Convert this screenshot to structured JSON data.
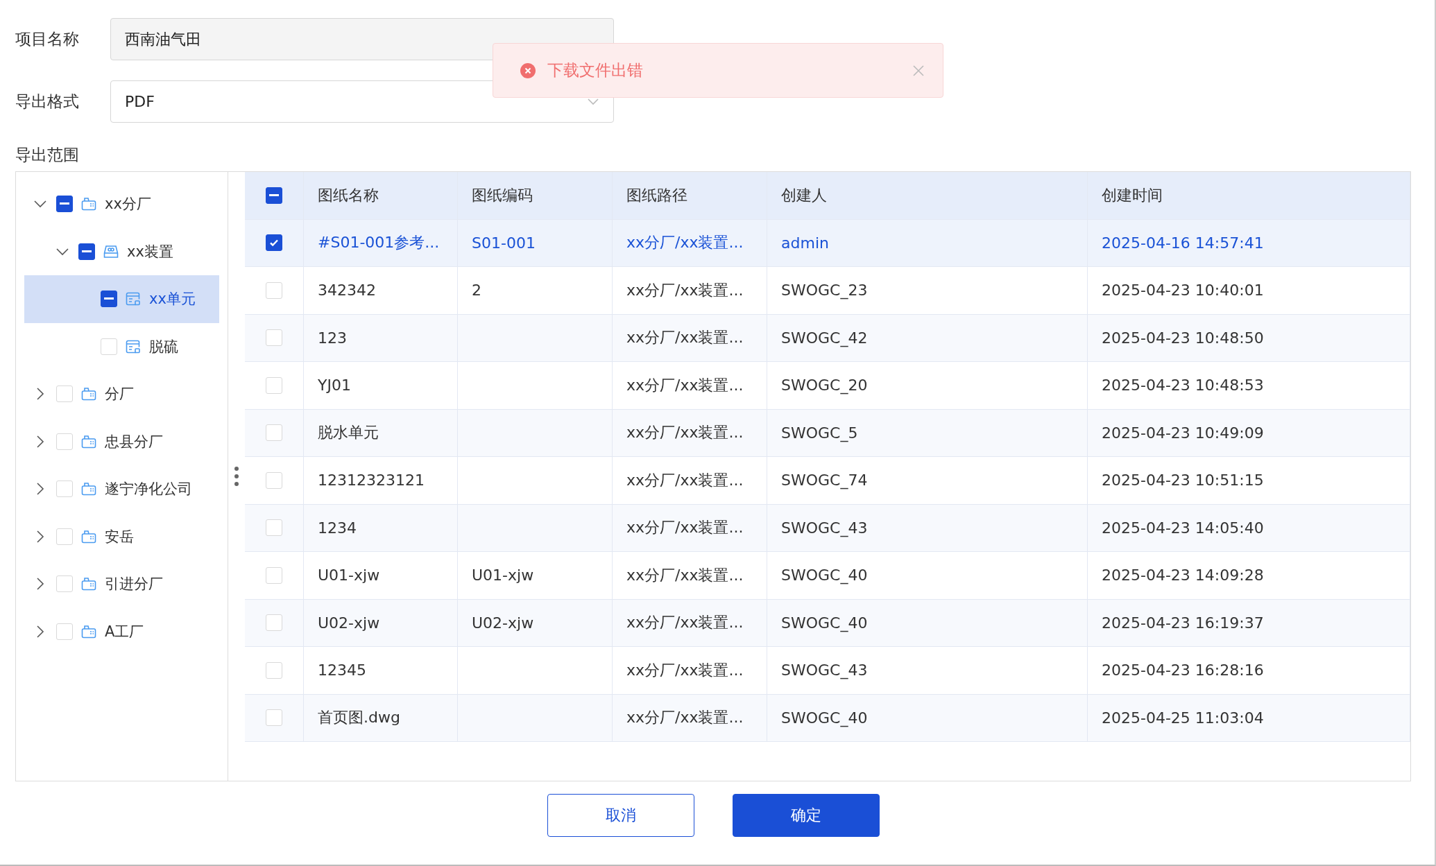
{
  "form": {
    "project": {
      "label": "项目名称",
      "value": "西南油气田"
    },
    "format": {
      "label": "导出格式",
      "value": "PDF"
    },
    "scope_label": "导出范围"
  },
  "toast": {
    "message": "下载文件出错"
  },
  "tree": [
    {
      "label": "xx分厂",
      "kind": "factory",
      "expanded": true,
      "checked": false,
      "indeterminate": true,
      "selected": false,
      "children": [
        {
          "label": "xx装置",
          "kind": "device",
          "expanded": true,
          "checked": false,
          "indeterminate": true,
          "selected": false,
          "children": [
            {
              "label": "xx单元",
              "kind": "unit",
              "checked": false,
              "indeterminate": true,
              "selected": true
            },
            {
              "label": "脱硫",
              "kind": "unit",
              "checked": false,
              "indeterminate": false,
              "selected": false
            }
          ]
        }
      ]
    },
    {
      "label": "分厂",
      "kind": "factory",
      "expanded": false,
      "checked": false,
      "indeterminate": false,
      "selected": false
    },
    {
      "label": "忠县分厂",
      "kind": "factory",
      "expanded": false,
      "checked": false,
      "indeterminate": false,
      "selected": false
    },
    {
      "label": "遂宁净化公司",
      "kind": "factory",
      "expanded": false,
      "checked": false,
      "indeterminate": false,
      "selected": false
    },
    {
      "label": "安岳",
      "kind": "factory",
      "expanded": false,
      "checked": false,
      "indeterminate": false,
      "selected": false
    },
    {
      "label": "引进分厂",
      "kind": "factory",
      "expanded": false,
      "checked": false,
      "indeterminate": false,
      "selected": false
    },
    {
      "label": "A工厂",
      "kind": "factory",
      "expanded": false,
      "checked": false,
      "indeterminate": false,
      "selected": false
    }
  ],
  "table": {
    "header_checkbox": {
      "checked": false,
      "indeterminate": true
    },
    "columns": [
      "图纸名称",
      "图纸编码",
      "图纸路径",
      "创建人",
      "创建时间"
    ],
    "rows": [
      {
        "checked": true,
        "cells": [
          "#S01-001参考...",
          "S01-001",
          "xx分厂/xx装置...",
          "admin",
          "2025-04-16 14:57:41"
        ]
      },
      {
        "checked": false,
        "cells": [
          "342342",
          "2",
          "xx分厂/xx装置...",
          "SWOGC_23",
          "2025-04-23 10:40:01"
        ]
      },
      {
        "checked": false,
        "cells": [
          "123",
          "",
          "xx分厂/xx装置...",
          "SWOGC_42",
          "2025-04-23 10:48:50"
        ]
      },
      {
        "checked": false,
        "cells": [
          "YJ01",
          "",
          "xx分厂/xx装置...",
          "SWOGC_20",
          "2025-04-23 10:48:53"
        ]
      },
      {
        "checked": false,
        "cells": [
          "脱水单元",
          "",
          "xx分厂/xx装置...",
          "SWOGC_5",
          "2025-04-23 10:49:09"
        ]
      },
      {
        "checked": false,
        "cells": [
          "12312323121",
          "",
          "xx分厂/xx装置...",
          "SWOGC_74",
          "2025-04-23 10:51:15"
        ]
      },
      {
        "checked": false,
        "cells": [
          "1234",
          "",
          "xx分厂/xx装置...",
          "SWOGC_43",
          "2025-04-23 14:05:40"
        ]
      },
      {
        "checked": false,
        "cells": [
          "U01-xjw",
          "U01-xjw",
          "xx分厂/xx装置...",
          "SWOGC_40",
          "2025-04-23 14:09:28"
        ]
      },
      {
        "checked": false,
        "cells": [
          "U02-xjw",
          "U02-xjw",
          "xx分厂/xx装置...",
          "SWOGC_40",
          "2025-04-23 16:19:37"
        ]
      },
      {
        "checked": false,
        "cells": [
          "12345",
          "",
          "xx分厂/xx装置...",
          "SWOGC_43",
          "2025-04-23 16:28:16"
        ]
      },
      {
        "checked": false,
        "cells": [
          "首页图.dwg",
          "",
          "xx分厂/xx装置...",
          "SWOGC_40",
          "2025-04-25 11:03:04"
        ]
      }
    ]
  },
  "buttons": {
    "cancel": "取消",
    "confirm": "确定"
  }
}
